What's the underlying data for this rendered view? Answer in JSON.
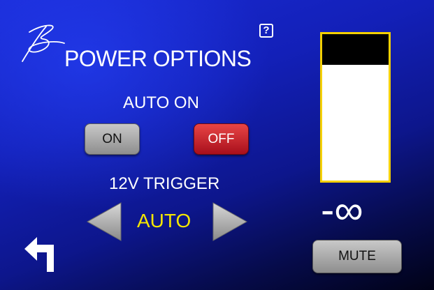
{
  "header": {
    "title": "POWER OPTIONS",
    "help_label": "?"
  },
  "auto_on": {
    "label": "AUTO ON",
    "on_label": "ON",
    "off_label": "OFF",
    "selected": "OFF"
  },
  "trigger": {
    "label": "12V TRIGGER",
    "value": "AUTO"
  },
  "volume": {
    "display": "-∞",
    "meter_level_fraction": 0.21,
    "mute_label": "MUTE"
  },
  "icons": {
    "logo": "signature-logo-icon",
    "help": "help-icon",
    "prev": "arrow-left-icon",
    "next": "arrow-right-icon",
    "back": "back-arrow-icon"
  },
  "colors": {
    "accent_yellow": "#f4e600",
    "off_red": "#c8202e",
    "meter_border": "#f4d000"
  }
}
